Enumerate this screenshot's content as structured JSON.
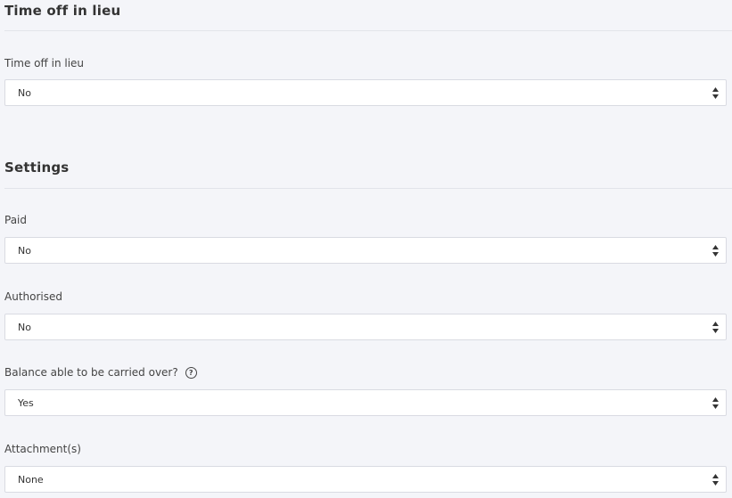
{
  "toil_section": {
    "title": "Time off in lieu",
    "field_label": "Time off in lieu",
    "field_value": "No"
  },
  "settings_section": {
    "title": "Settings",
    "fields": [
      {
        "label": "Paid",
        "value": "No"
      },
      {
        "label": "Authorised",
        "value": "No"
      },
      {
        "label": "Balance able to be carried over?",
        "value": "Yes",
        "help_icon": "question-circle-icon"
      },
      {
        "label": "Attachment(s)",
        "value": "None"
      }
    ]
  },
  "icons": {
    "select_arrows": "sort-arrows-icon",
    "help_glyph": "?"
  }
}
